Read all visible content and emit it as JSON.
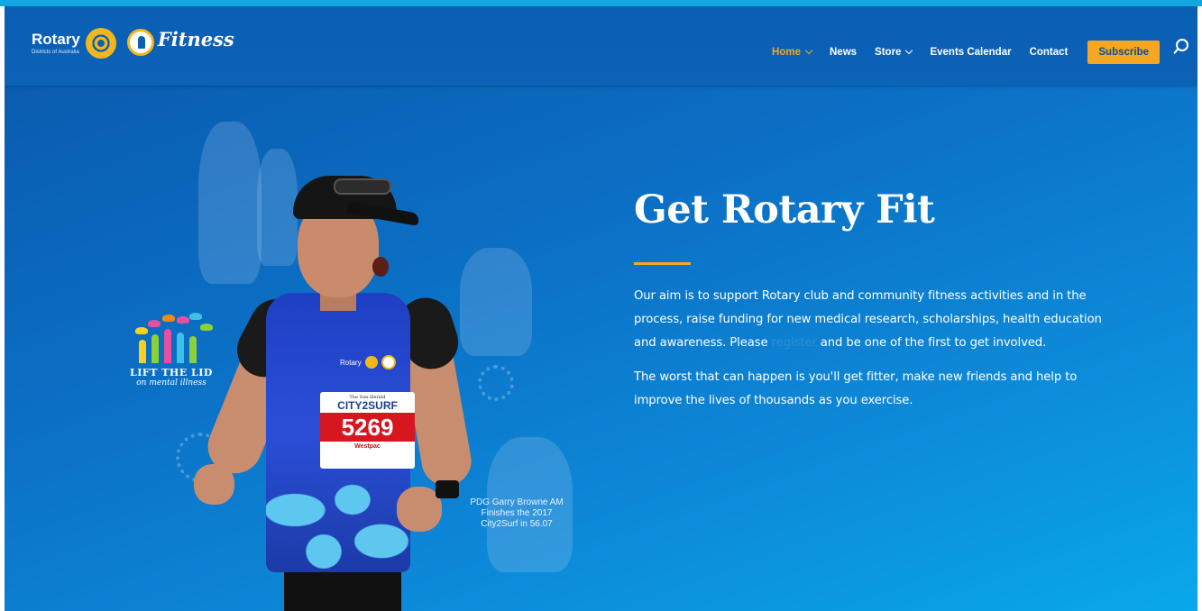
{
  "header": {
    "logo_rotary": "Rotary",
    "logo_districts": "Districts of Australia",
    "logo_fitness": "Fitness",
    "nav": [
      {
        "label": "Home",
        "dropdown": true,
        "active": true
      },
      {
        "label": "News",
        "dropdown": false,
        "active": false
      },
      {
        "label": "Store",
        "dropdown": true,
        "active": false
      },
      {
        "label": "Events Calendar",
        "dropdown": false,
        "active": false
      },
      {
        "label": "Contact",
        "dropdown": false,
        "active": false
      }
    ],
    "subscribe_label": "Subscribe"
  },
  "hero": {
    "title": "Get Rotary Fit",
    "paragraph1_before": "Our aim is to support Rotary club and community fitness activities and in the process, raise funding for new medical research, scholarships, health education and awareness. Please ",
    "paragraph1_link": "register",
    "paragraph1_after": " and be one of the first to get involved.",
    "paragraph2": "The worst that can happen is you'll get fitter, make new friends and help to improve the lives of thousands as you exercise.",
    "photo_caption": "PDG Garry Browne AM Finishes the 2017 City2Surf in 56.07",
    "bib": {
      "paper": "The Sun-Herald",
      "event": "CITY2SURF",
      "number": "5269",
      "sponsor": "Westpac"
    },
    "jersey_text": "Rotary",
    "lid_logo": {
      "title": "LIFT THE LID",
      "subtitle": "on mental illness"
    }
  },
  "colors": {
    "accent": "#f5a623",
    "header_bg": "#0a5fb4",
    "hero_start": "#0a5cb0",
    "hero_end": "#09a8ea"
  }
}
